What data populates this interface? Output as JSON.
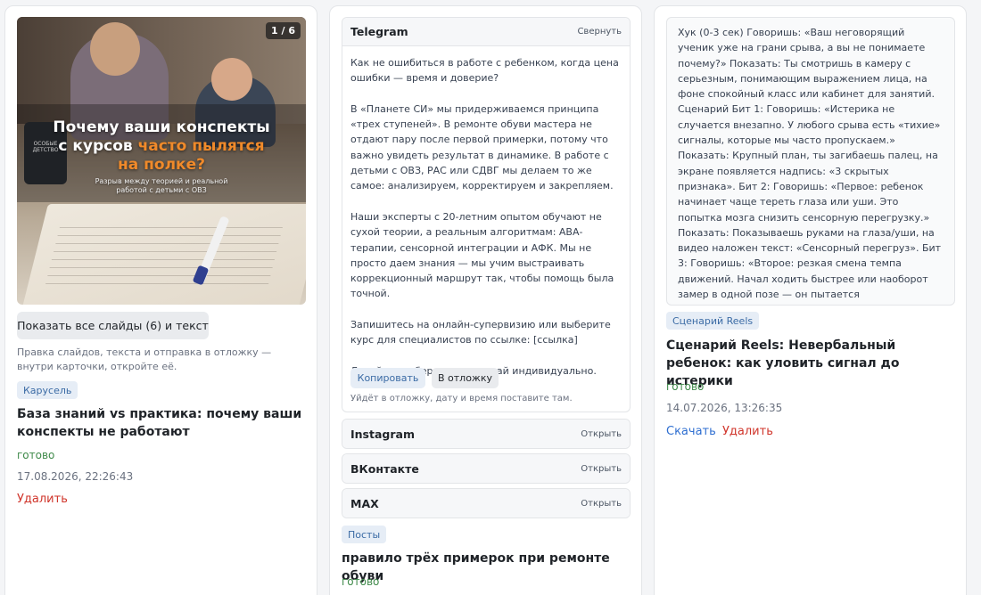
{
  "cards": [
    {
      "slide": {
        "counter": "1 / 6",
        "title_line1": "Почему ваши конспекты",
        "title_line2_plain": "с курсов ",
        "title_line2_accent": "часто пылятся",
        "title_line3_accent": "на полке?",
        "subtitle_line1": "Разрыв между теорией и реальной",
        "subtitle_line2": "работой с детьми с ОВЗ",
        "mug_label": "ОСОБЫЕ ДЕТСТВО",
        "accent_color": "#f08a2a"
      },
      "show_slides_label": "Показать все слайды (6) и текст",
      "hint": "Правка слайдов, текста и отправка в отложку — внутри карточки, откройте её.",
      "tag": "Карусель",
      "title": "База знаний vs практика: почему ваши конспекты не работают",
      "status": "готово",
      "date": "17.08.2026, 22:26:43",
      "delete_label": "Удалить"
    },
    {
      "telegram": {
        "name": "Telegram",
        "action": "Свернуть",
        "text": "Как не ошибиться в работе с ребенком, когда цена ошибки — время и доверие?\n\nВ «Планете СИ» мы придерживаемся принципа «трех ступеней». В ремонте обуви мастера не отдают пару после первой примерки, потому что важно увидеть результат в динамике. В работе с детьми с ОВЗ, РАС или СДВГ мы делаем то же самое: анализируем, корректируем и закрепляем.\n\nНаши эксперты с 20-летним опытом обучают не сухой теории, а реальным алгоритмам: АВА-терапии, сенсорной интеграции и АФК. Мы не просто даем знания — мы учим выстраивать коррекционный маршрут так, чтобы помощь была точной.\n\nЗапишитесь на онлайн-супервизию или выберите курс для специалистов по ссылке: [ссылка]\n\nДавайте разберем ваш случай индивидуально.",
        "copy_label": "Копировать",
        "schedule_label": "В отложку",
        "hint": "Уйдёт в отложку, дату и время поставите там."
      },
      "platforms": [
        {
          "name": "Instagram",
          "action": "Открыть"
        },
        {
          "name": "ВКонтакте",
          "action": "Открыть"
        },
        {
          "name": "MAX",
          "action": "Открыть"
        }
      ],
      "tag": "Посты",
      "title": "правило трёх примерок при ремонте обуви",
      "status": "готово"
    },
    {
      "script": "Хук (0-3 сек) Говоришь: «Ваш неговорящий ученик уже на грани срыва, а вы не понимаете почему?» Показать: Ты смотришь в камеру с серьезным, понимающим выражением лица, на фоне спокойный класс или кабинет для занятий. Сценарий Бит 1: Говоришь: «Истерика не случается внезапно. У любого срыва есть «тихие» сигналы, которые мы часто пропускаем.» Показать: Крупный план, ты загибаешь палец, на экране появляется надпись: «3 скрытых признака». Бит 2: Говоришь: «Первое: ребенок начинает чаще тереть глаза или уши. Это попытка мозга снизить сенсорную перегрузку.» Показать: Показываешь руками на глаза/уши, на видео наложен текст: «Сенсорный перегруз». Бит 3: Говоришь: «Второе: резкая смена темпа движений. Начал ходить быстрее или наоборот замер в одной позе — он пытается «заземлиться».» Показать: Быстрая смена кадров: ты показываешь хаотичное движение руками, потом",
      "tag": "Сценарий Reels",
      "title": "Сценарий Reels: Невербальный ребенок: как уловить сигнал до истерики",
      "status": "готово",
      "date": "14.07.2026, 13:26:35",
      "download_label": "Скачать",
      "delete_label": "Удалить"
    }
  ]
}
